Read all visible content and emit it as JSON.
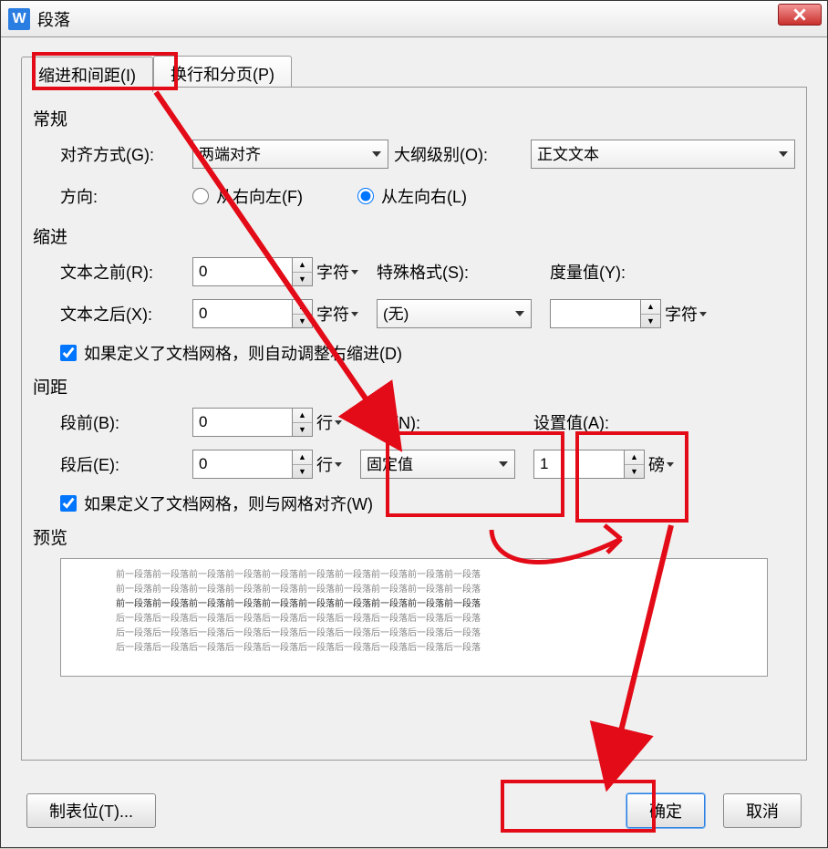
{
  "window": {
    "title": "段落"
  },
  "tabs": [
    {
      "label": "缩进和间距(I)",
      "active": true
    },
    {
      "label": "换行和分页(P)",
      "active": false
    }
  ],
  "general": {
    "heading": "常规",
    "alignment_label": "对齐方式(G):",
    "alignment_value": "两端对齐",
    "outline_label": "大纲级别(O):",
    "outline_value": "正文文本",
    "direction_label": "方向:",
    "direction_rtl": "从右向左(F)",
    "direction_ltr": "从左向右(L)"
  },
  "indent": {
    "heading": "缩进",
    "before_label": "文本之前(R):",
    "before_value": "0",
    "before_unit": "字符",
    "after_label": "文本之后(X):",
    "after_value": "0",
    "after_unit": "字符",
    "special_label": "特殊格式(S):",
    "special_value": "(无)",
    "measure_label": "度量值(Y):",
    "measure_value": "",
    "measure_unit": "字符",
    "grid_check": "如果定义了文档网格，则自动调整右缩进(D)"
  },
  "spacing": {
    "heading": "间距",
    "before_label": "段前(B):",
    "before_value": "0",
    "before_unit": "行",
    "after_label": "段后(E):",
    "after_value": "0",
    "after_unit": "行",
    "linespacing_label": "行距(N):",
    "linespacing_value": "固定值",
    "setat_label": "设置值(A):",
    "setat_value": "1",
    "setat_unit": "磅",
    "grid_check": "如果定义了文档网格，则与网格对齐(W)"
  },
  "preview": {
    "heading": "预览"
  },
  "footer": {
    "tabs_button": "制表位(T)...",
    "ok": "确定",
    "cancel": "取消"
  }
}
